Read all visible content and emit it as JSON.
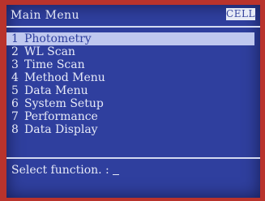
{
  "header": {
    "title": "Main Menu",
    "badge": "CELL"
  },
  "menu": {
    "selected_index": 0,
    "items": [
      {
        "number": "1",
        "label": "Photometry"
      },
      {
        "number": "2",
        "label": "WL Scan"
      },
      {
        "number": "3",
        "label": "Time Scan"
      },
      {
        "number": "4",
        "label": "Method Menu"
      },
      {
        "number": "5",
        "label": "Data Menu"
      },
      {
        "number": "6",
        "label": "System Setup"
      },
      {
        "number": "7",
        "label": "Performance"
      },
      {
        "number": "8",
        "label": "Data Display"
      }
    ]
  },
  "prompt": {
    "text": "Select function. :"
  },
  "colors": {
    "screen_background": "#2f3f9e",
    "highlight": "#bfc8ef",
    "text": "#e7eaf7",
    "bezel": "#b9332c"
  }
}
